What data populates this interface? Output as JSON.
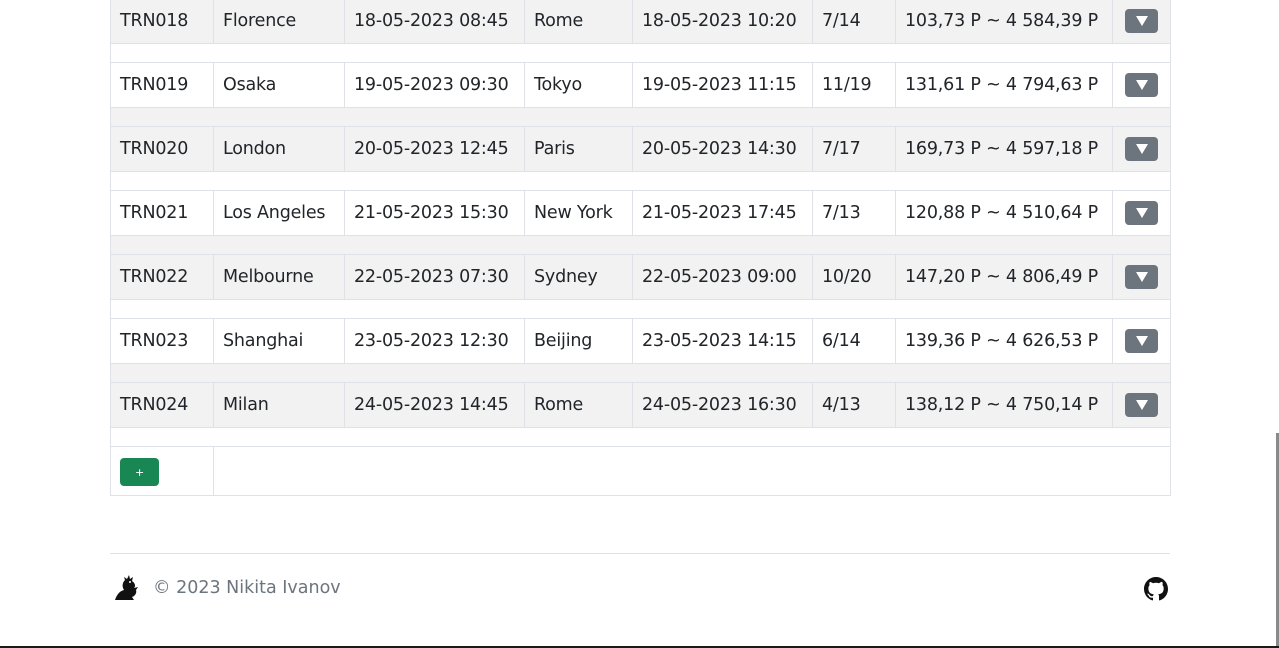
{
  "trips": [
    {
      "id": "TRN018",
      "from": "Florence",
      "departure": "18-05-2023 08:45",
      "to": "Rome",
      "arrival": "18-05-2023 10:20",
      "seats": "7/14",
      "price": "103,73 P ~ 4 584,39 P"
    },
    {
      "id": "TRN019",
      "from": "Osaka",
      "departure": "19-05-2023 09:30",
      "to": "Tokyo",
      "arrival": "19-05-2023 11:15",
      "seats": "11/19",
      "price": "131,61 P ~ 4 794,63 P"
    },
    {
      "id": "TRN020",
      "from": "London",
      "departure": "20-05-2023 12:45",
      "to": "Paris",
      "arrival": "20-05-2023 14:30",
      "seats": "7/17",
      "price": "169,73 P ~ 4 597,18 P"
    },
    {
      "id": "TRN021",
      "from": "Los Angeles",
      "departure": "21-05-2023 15:30",
      "to": "New York",
      "arrival": "21-05-2023 17:45",
      "seats": "7/13",
      "price": "120,88 P ~ 4 510,64 P"
    },
    {
      "id": "TRN022",
      "from": "Melbourne",
      "departure": "22-05-2023 07:30",
      "to": "Sydney",
      "arrival": "22-05-2023 09:00",
      "seats": "10/20",
      "price": "147,20 P ~ 4 806,49 P"
    },
    {
      "id": "TRN023",
      "from": "Shanghai",
      "departure": "23-05-2023 12:30",
      "to": "Beijing",
      "arrival": "23-05-2023 14:15",
      "seats": "6/14",
      "price": "139,36 P ~ 4 626,53 P"
    },
    {
      "id": "TRN024",
      "from": "Milan",
      "departure": "24-05-2023 14:45",
      "to": "Rome",
      "arrival": "24-05-2023 16:30",
      "seats": "4/13",
      "price": "138,12 P ~ 4 750,14 P"
    }
  ],
  "row_action_icon": "chevron-down-icon",
  "add_button_label": "+",
  "footer": {
    "copyright": "© 2023 Nikita Ivanov",
    "logo_icon": "dragon-logo-icon",
    "github_icon": "github-icon"
  },
  "colors": {
    "row_stripe": "#f2f2f2",
    "action_button": "#6c757d",
    "add_button": "#198754",
    "muted_text": "#6c757d"
  }
}
